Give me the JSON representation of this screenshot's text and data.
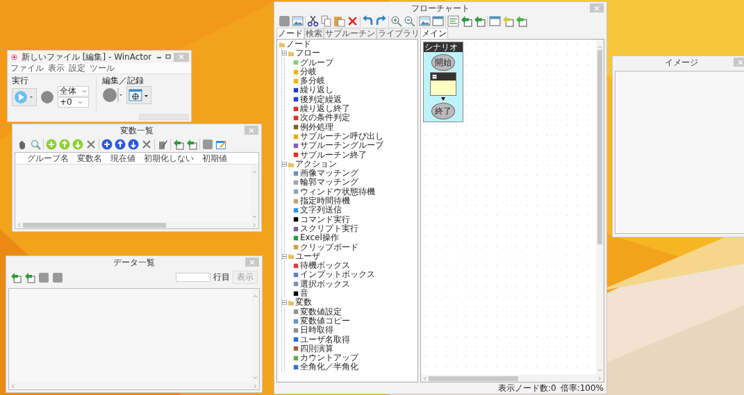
{
  "winactor": {
    "title": "新しいファイル [編集] - WinActor",
    "menu": [
      "ファイル",
      "表示",
      "設定",
      "ツール"
    ],
    "run_group": "実行",
    "scope_select": "全体",
    "offset_select": "+0",
    "edit_group": "編集／記録"
  },
  "variables": {
    "title": "変数一覧",
    "columns": [
      "グループ名",
      "変数名",
      "現在値",
      "初期化しない",
      "初期値"
    ]
  },
  "data_list": {
    "title": "データ一覧",
    "row_label": "行目",
    "show_button": {
      "label": "表示",
      "disabled": true
    }
  },
  "flowchart": {
    "title": "フローチャート",
    "palette_tabs": [
      {
        "label": "ノード",
        "selected": true
      },
      {
        "label": "検索",
        "selected": false
      },
      {
        "label": "サブルーチン",
        "selected": false
      },
      {
        "label": "ライブラリ",
        "selected": false
      }
    ],
    "tree": {
      "label": "ノード",
      "children": [
        {
          "label": "フロー",
          "expanded": true,
          "children": [
            {
              "label": "グループ",
              "color": "#7fd07f"
            },
            {
              "label": "分岐",
              "color": "#f0b400"
            },
            {
              "label": "多分岐",
              "color": "#f0b400"
            },
            {
              "label": "繰り返し",
              "color": "#2040d0"
            },
            {
              "label": "後判定繰返",
              "color": "#2040d0"
            },
            {
              "label": "繰り返し終了",
              "color": "#e03020"
            },
            {
              "label": "次の条件判定",
              "color": "#e03020"
            },
            {
              "label": "例外処理",
              "color": "#806020"
            },
            {
              "label": "サブルーチン呼び出し",
              "color": "#e0b000"
            },
            {
              "label": "サブルーチングループ",
              "color": "#8060c0"
            },
            {
              "label": "サブルーチン終了",
              "color": "#e03020"
            }
          ]
        },
        {
          "label": "アクション",
          "expanded": true,
          "children": [
            {
              "label": "画像マッチング",
              "color": "#7090c0"
            },
            {
              "label": "輪郭マッチング",
              "color": "#a0a0c0"
            },
            {
              "label": "ウィンドウ状態待機",
              "color": "#90a0c0"
            },
            {
              "label": "指定時間待機",
              "color": "#c0a080"
            },
            {
              "label": "文字列送信",
              "color": "#3090e0"
            },
            {
              "label": "コマンド実行",
              "color": "#000000"
            },
            {
              "label": "スクリプト実行",
              "color": "#8060a0"
            },
            {
              "label": "Excel操作",
              "color": "#20a040"
            },
            {
              "label": "クリップボード",
              "color": "#d0a040"
            }
          ]
        },
        {
          "label": "ユーザ",
          "expanded": true,
          "children": [
            {
              "label": "待機ボックス",
              "color": "#e04040"
            },
            {
              "label": "インプットボックス",
              "color": "#6080c0"
            },
            {
              "label": "選択ボックス",
              "color": "#8090b0"
            },
            {
              "label": "音",
              "color": "#000000"
            }
          ]
        },
        {
          "label": "変数",
          "expanded": true,
          "children": [
            {
              "label": "変数値設定",
              "color": "#909090"
            },
            {
              "label": "変数値コピー",
              "color": "#7090c0"
            },
            {
              "label": "日時取得",
              "color": "#909090"
            },
            {
              "label": "ユーザ名取得",
              "color": "#3070d0"
            },
            {
              "label": "四則演算",
              "color": "#a06040"
            },
            {
              "label": "カウントアップ",
              "color": "#60b040"
            },
            {
              "label": "全角化／半角化",
              "color": "#3070d0"
            }
          ]
        }
      ]
    },
    "canvas_tabs": [
      {
        "label": "メイン",
        "selected": true
      }
    ],
    "scenario": {
      "label": "シナリオ",
      "start": "開始",
      "end": "終了"
    },
    "node_count": "表示ノード数:0",
    "zoom": "倍率:100%"
  },
  "image": {
    "title": "イメージ"
  }
}
